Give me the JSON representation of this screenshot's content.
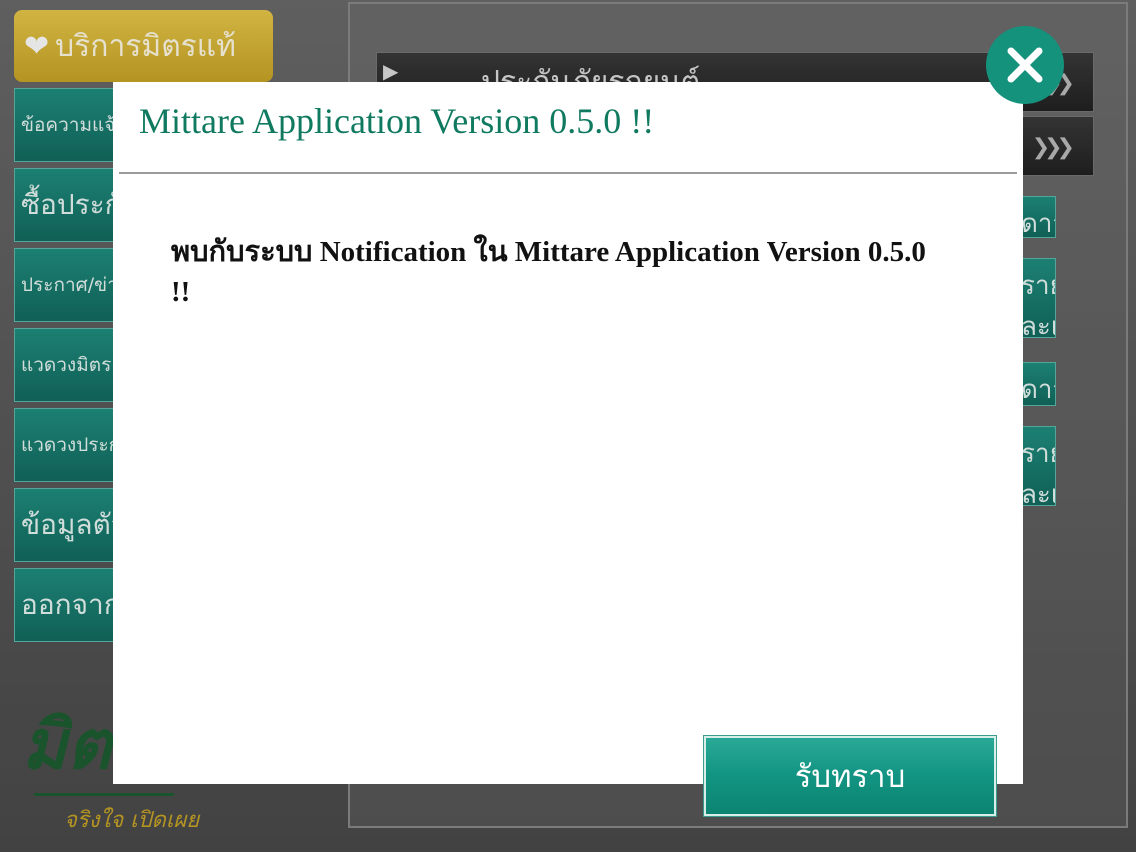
{
  "background": {
    "brand_tab": "บริการมิตรแท้",
    "menu": [
      {
        "label": "ข้อความแจ้งเตือน",
        "size": "small"
      },
      {
        "label": "ซื้อประกันภัย",
        "size": "big"
      },
      {
        "label": "ประกาศ/ข่าวสาร",
        "size": "small"
      },
      {
        "label": "แวดวงมิตรแท้",
        "size": "small"
      },
      {
        "label": "แวดวงประกันภัย",
        "size": "small"
      },
      {
        "label": "ข้อมูลตัวแทน",
        "size": "big"
      },
      {
        "label": "ออกจากระบบ",
        "size": "big"
      }
    ],
    "bars": [
      {
        "title": "ประกันภัยรถยนต์"
      },
      {
        "title": ""
      }
    ],
    "right_buttons": [
      "ดาวน์โหลด",
      "รายละเอียดโปรไฟล์",
      "ดาวน์โหลด",
      "รายละเอียดโปรไฟล์"
    ],
    "logo": {
      "script": "มิตรแท้",
      "tagline": "จริงใจ เปิดเผย"
    }
  },
  "modal": {
    "title": "Mittare Application Version 0.5.0 !!",
    "message": "พบกับระบบ Notification ใน Mittare Application Version 0.5.0 !!",
    "ok_label": "รับทราบ",
    "close_icon": "close-x-icon"
  },
  "colors": {
    "accent": "#15927c",
    "title_text": "#0f7a5f",
    "brand_gold": "#c9a526"
  }
}
